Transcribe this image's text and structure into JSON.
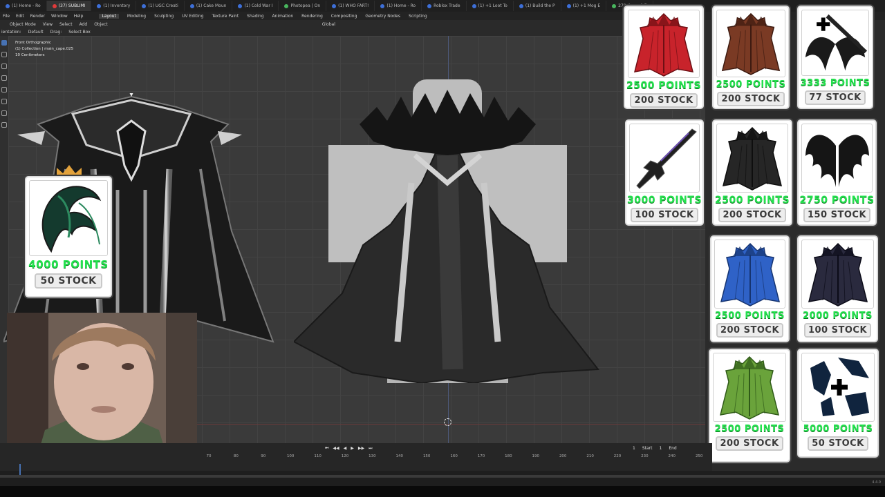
{
  "browser": {
    "tabs": [
      {
        "label": "(1) Home - Ro",
        "kind": "blue"
      },
      {
        "label": "(37) SUBLIMI",
        "kind": "red",
        "active": true
      },
      {
        "label": "(1) Inventory",
        "kind": "blue"
      },
      {
        "label": "(1) UGC Creati",
        "kind": "blue"
      },
      {
        "label": "(1) Cake Moun",
        "kind": "blue"
      },
      {
        "label": "(1) Cold War I",
        "kind": "blue"
      },
      {
        "label": "Photopea | On",
        "kind": "green"
      },
      {
        "label": "(1) WHO FART!",
        "kind": "blue"
      },
      {
        "label": "(1) Home - Ro",
        "kind": "blue"
      },
      {
        "label": "Roblox Trade",
        "kind": "blue"
      },
      {
        "label": "(1) +1 Loot To",
        "kind": "blue"
      },
      {
        "label": "(1) Build the P",
        "kind": "blue"
      },
      {
        "label": "(1) +1 Mog E",
        "kind": "blue"
      },
      {
        "label": "270 times 0.7",
        "kind": "green"
      }
    ]
  },
  "blender": {
    "menu": [
      "File",
      "Edit",
      "Render",
      "Window",
      "Help"
    ],
    "workspaces": [
      "Layout",
      "Modeling",
      "Sculpting",
      "UV Editing",
      "Texture Paint",
      "Shading",
      "Animation",
      "Rendering",
      "Compositing",
      "Geometry Nodes",
      "Scripting"
    ],
    "active_workspace": "Layout",
    "header": {
      "mode": "Object Mode",
      "view": "View",
      "select": "Select",
      "add": "Add",
      "object": "Object",
      "transform": "Global"
    },
    "header2": {
      "orientation_label": "ientation:",
      "orientation_value": "Default",
      "drag_label": "Drag:",
      "drag_value": "Select Box"
    },
    "viewport_info": {
      "line1": "Front Orthographic",
      "line2": "(1) Collection | main_cape.025",
      "line3": "10 Centimeters"
    },
    "timeline": {
      "frame": "1",
      "start_label": "Start",
      "start_value": "1",
      "end_label": "End",
      "ticks": [
        "70",
        "80",
        "90",
        "100",
        "110",
        "120",
        "130",
        "140",
        "150",
        "160",
        "170",
        "180",
        "190",
        "200",
        "210",
        "220",
        "230",
        "240",
        "250"
      ]
    },
    "version": "4.4.0"
  },
  "shop": {
    "featured": {
      "points": "4000 POINTS",
      "stock": "50 STOCK"
    },
    "items": [
      {
        "name": "red-cape",
        "color": "#c8232b",
        "points": "2500 POINTS",
        "stock": "200 STOCK"
      },
      {
        "name": "brown-cape",
        "color": "#7a3a24",
        "points": "2500 POINTS",
        "stock": "200 STOCK"
      },
      {
        "name": "sword-wings-bundle",
        "color": "#1a1a1a",
        "points": "3333 POINTS",
        "stock": "77 STOCK"
      },
      {
        "name": "dark-sword",
        "color": "#222222",
        "points": "3000 POINTS",
        "stock": "100 STOCK"
      },
      {
        "name": "black-cape",
        "color": "#262626",
        "points": "2500 POINTS",
        "stock": "200 STOCK"
      },
      {
        "name": "dark-wings",
        "color": "#151515",
        "points": "2750 POINTS",
        "stock": "150 STOCK"
      },
      {
        "name": "blue-cape",
        "color": "#2f62c7",
        "points": "2500 POINTS",
        "stock": "200 STOCK"
      },
      {
        "name": "ornate-cape",
        "color": "#2a2a3e",
        "points": "2000 POINTS",
        "stock": "100 STOCK"
      },
      {
        "name": "green-cape",
        "color": "#6aa33b",
        "points": "2500 POINTS",
        "stock": "200 STOCK"
      },
      {
        "name": "blue-crystal-bundle",
        "color": "#10243e",
        "points": "5000 POINTS",
        "stock": "50 STOCK"
      }
    ]
  }
}
